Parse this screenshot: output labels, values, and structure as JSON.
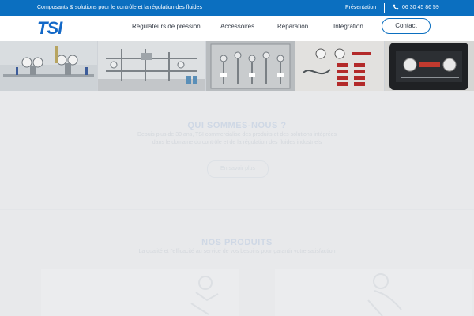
{
  "topbar": {
    "tagline": "Composants & solutions pour le contrôle et la régulation des fluides",
    "presentation": "Présentation",
    "phone": "06 30 45 86 59",
    "phone_icon": "phone-icon"
  },
  "nav": {
    "logo": "TSI",
    "items": [
      "Régulateurs de pression",
      "Accessoires",
      "Réparation",
      "Intégration"
    ],
    "contact": "Contact"
  },
  "about": {
    "title": "QUI SOMMES-NOUS ?",
    "line1": "Depuis plus de 30 ans, TSI commercialise des produits et des solutions intégrées",
    "line2": "dans le domaine du contrôle et de la régulation des fluides industriels",
    "button": "En savoir plus"
  },
  "products": {
    "title": "NOS PRODUITS",
    "line1": "La qualité et l'efficacité au service de vos besoins pour garantir votre satisfaction"
  },
  "colors": {
    "brand": "#0b6fc0",
    "logo": "#1268c7"
  }
}
